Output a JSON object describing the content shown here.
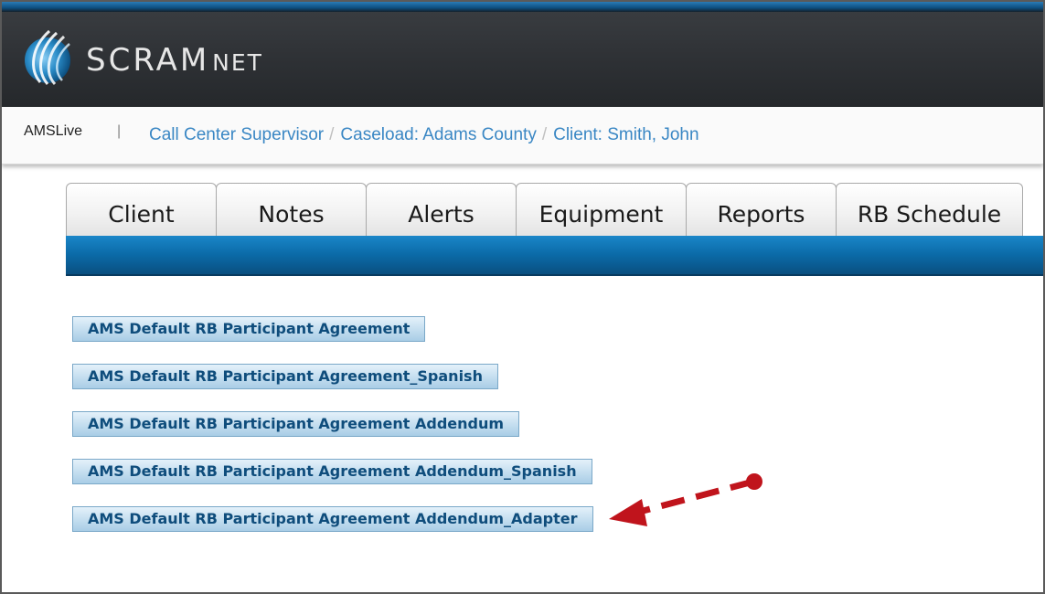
{
  "header": {
    "logo_main": "SCRAM",
    "logo_suffix": "NET"
  },
  "breadcrumb": {
    "app_name": "AMSLive",
    "divider": "|",
    "items": [
      {
        "label": "Call Center Supervisor"
      },
      {
        "label": "Caseload: Adams County"
      },
      {
        "label": "Client: Smith, John"
      }
    ],
    "separator": "/"
  },
  "tabs": [
    {
      "label": "Client"
    },
    {
      "label": "Notes"
    },
    {
      "label": "Alerts"
    },
    {
      "label": "Equipment"
    },
    {
      "label": "Reports"
    },
    {
      "label": "RB Schedule"
    }
  ],
  "documents": [
    {
      "label": "AMS Default RB Participant Agreement"
    },
    {
      "label": "AMS Default RB Participant Agreement_Spanish"
    },
    {
      "label": "AMS Default RB Participant Agreement Addendum"
    },
    {
      "label": "AMS Default RB Participant Agreement Addendum_Spanish"
    },
    {
      "label": "AMS Default RB Participant Agreement Addendum_Adapter"
    }
  ],
  "colors": {
    "accent_blue": "#0b6aa7",
    "link_blue": "#3a87c4",
    "annotation_red": "#c0141c"
  },
  "icons": {
    "logo": "scramnet-logo-icon",
    "annotation": "dashed-arrow-icon"
  }
}
